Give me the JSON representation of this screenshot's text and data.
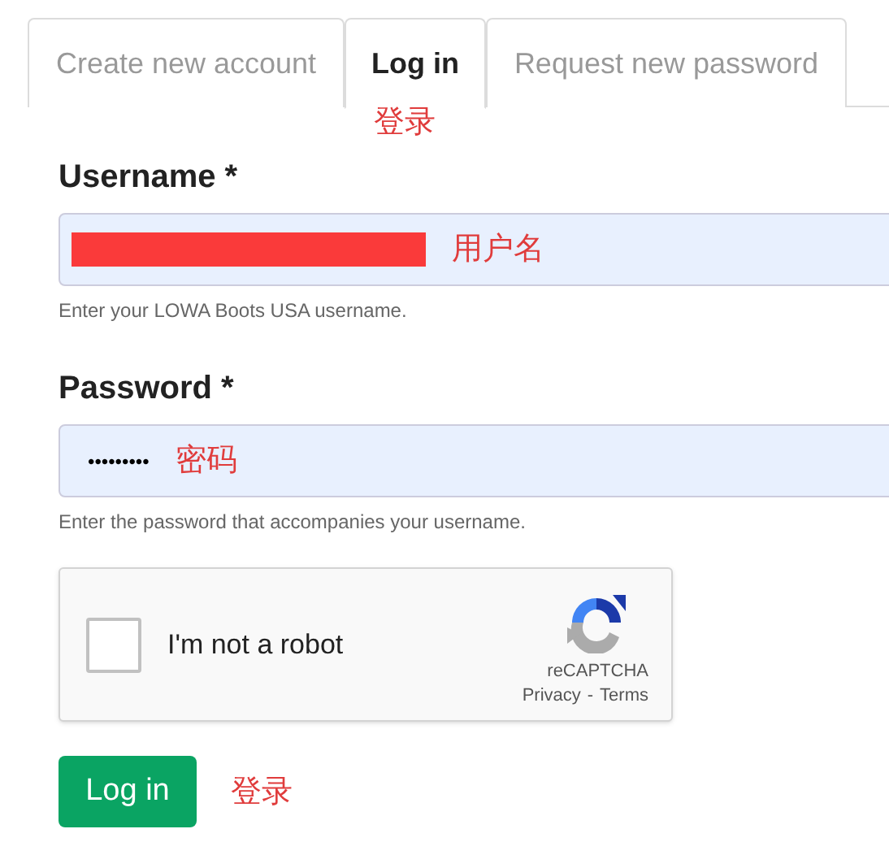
{
  "tabs": [
    {
      "label": "Create new account",
      "selected": false
    },
    {
      "label": "Log in",
      "selected": true,
      "annotation": "登录"
    },
    {
      "label": "Request new password",
      "selected": false
    }
  ],
  "fields": [
    {
      "label": "Username *",
      "kind": "text",
      "redacted": true,
      "annotation": "用户名",
      "hint": "Enter your LOWA Boots USA username."
    },
    {
      "label": "Password *",
      "kind": "password",
      "value": "•••••••••",
      "annotation": "密码",
      "hint": "Enter the password that accompanies your username."
    }
  ],
  "captcha": {
    "label": "I'm not a robot",
    "checked": false,
    "brand": "reCAPTCHA",
    "privacy": "Privacy",
    "separator": "-",
    "terms": "Terms"
  },
  "submit": {
    "label": "Log in",
    "annotation": "登录"
  }
}
